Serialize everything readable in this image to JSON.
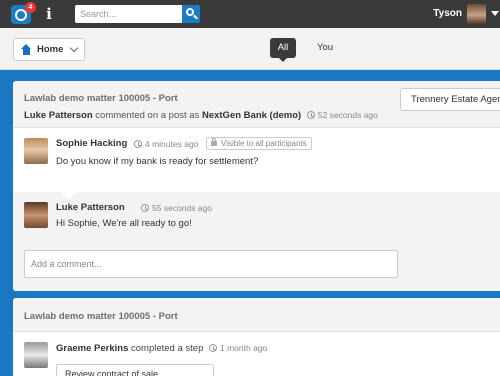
{
  "app": {
    "notification_count": "4",
    "search_placeholder": "Search...",
    "user_name": "Tyson"
  },
  "subnav": {
    "home_label": "Home",
    "tabs": [
      {
        "label": "All",
        "active": true
      },
      {
        "label": "You",
        "active": false
      }
    ]
  },
  "feed": [
    {
      "matter": "Lawlab demo matter 100005 - Port",
      "actor": "Luke Patterson",
      "action": "commented on a post as",
      "org": "NextGen Bank (demo)",
      "time": "52 seconds ago",
      "org_button": "Trennery Estate Agent",
      "post": {
        "author": "Sophie Hacking",
        "time": "4 minutes ago",
        "visibility": "Visible to all participants",
        "text": "Do you know if my bank is ready for settlement?"
      },
      "comment": {
        "author": "Luke Patterson",
        "time": "55 seconds ago",
        "text": "Hi Sophie, We're all ready to go!"
      },
      "comment_placeholder": "Add a comment..."
    },
    {
      "matter": "Lawlab demo matter 100005 - Port",
      "actor": "Graeme Perkins",
      "action": "completed a step",
      "time": "1 month ago",
      "step_label": "Review contract of sale"
    }
  ],
  "colors": {
    "topbar": "#3a3a3a",
    "accent": "#1b7cc3",
    "page_bg": "#1a78c2",
    "badge": "#e33333"
  }
}
